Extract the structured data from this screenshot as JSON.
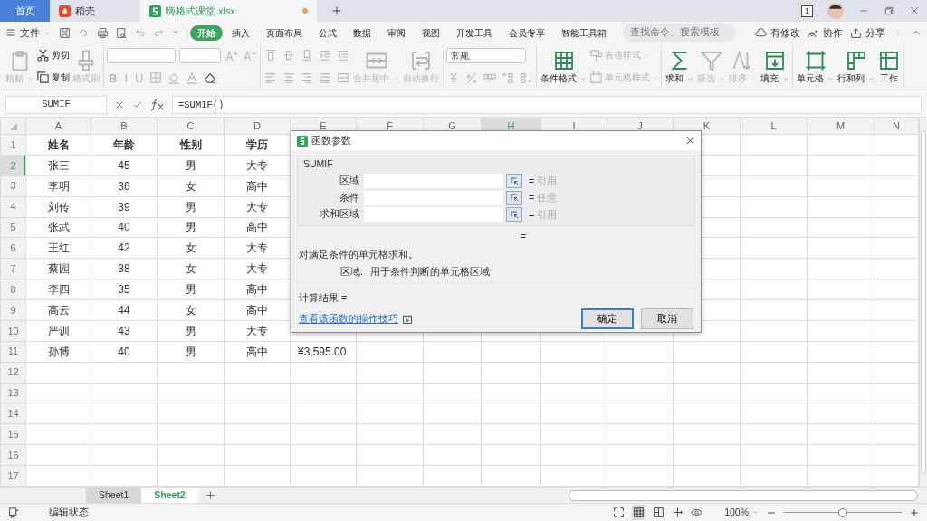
{
  "window_tabs": [
    {
      "label": "首页",
      "kind": "home",
      "selected": false
    },
    {
      "label": "稻壳",
      "kind": "docer",
      "selected": false
    },
    {
      "label": "嗨格式课堂.xlsx",
      "kind": "sheet",
      "selected": true,
      "modified": true
    }
  ],
  "window_count": "1",
  "menu": {
    "file": "文件",
    "tabs": [
      {
        "label": "开始",
        "selected": true
      },
      {
        "label": "插入",
        "selected": false
      },
      {
        "label": "页面布局",
        "selected": false
      },
      {
        "label": "公式",
        "selected": false
      },
      {
        "label": "数据",
        "selected": false
      },
      {
        "label": "审阅",
        "selected": false
      },
      {
        "label": "视图",
        "selected": false
      },
      {
        "label": "开发工具",
        "selected": false
      },
      {
        "label": "会员专享",
        "selected": false
      },
      {
        "label": "智能工具箱",
        "selected": false
      }
    ],
    "search": {
      "placeholder": "查找命令、搜索模板"
    },
    "actions": [
      "有修改",
      "协作",
      "分享"
    ]
  },
  "ribbon": [
    {
      "columns": [
        [
          {
            "kind": "large",
            "label": "粘贴",
            "disabled": true,
            "menu": true
          }
        ],
        [
          {
            "kind": "small",
            "label": "剪切",
            "disabled": false
          },
          {
            "kind": "small",
            "label": "复制",
            "disabled": false
          }
        ],
        [
          {
            "kind": "large",
            "label": "格式刷",
            "disabled": true,
            "menu": false
          }
        ]
      ]
    },
    {
      "columns": [
        [
          {
            "kind": "row",
            "items": [
              {
                "kind": "font-select"
              },
              {
                "kind": "size-select"
              },
              {
                "kind": "icon",
                "disabled": true
              },
              {
                "kind": "icon",
                "disabled": true
              }
            ]
          },
          {
            "kind": "row",
            "items": [
              {
                "kind": "format",
                "label": "B",
                "disabled": true
              },
              {
                "kind": "format",
                "label": "I",
                "disabled": true
              },
              {
                "kind": "format",
                "label": "U",
                "disabled": true
              },
              {
                "kind": "icon",
                "disabled": true
              },
              {
                "kind": "icon",
                "disabled": true
              },
              {
                "kind": "icon",
                "disabled": true
              },
              {
                "kind": "icon",
                "disabled": false
              }
            ]
          }
        ]
      ]
    },
    {
      "columns": [
        [
          {
            "kind": "row",
            "items": [
              {
                "kind": "icon",
                "disabled": true
              },
              {
                "kind": "icon",
                "disabled": true
              },
              {
                "kind": "icon",
                "disabled": true
              },
              {
                "kind": "icon",
                "disabled": true
              },
              {
                "kind": "icon",
                "disabled": true
              }
            ]
          },
          {
            "kind": "row",
            "items": [
              {
                "kind": "icon",
                "disabled": true
              },
              {
                "kind": "icon",
                "disabled": true
              },
              {
                "kind": "icon",
                "disabled": true
              },
              {
                "kind": "icon",
                "disabled": true
              },
              {
                "kind": "icon",
                "disabled": true
              }
            ]
          }
        ],
        [
          {
            "kind": "large",
            "label": "合并居中",
            "disabled": true,
            "menu": true
          }
        ],
        [
          {
            "kind": "large",
            "label": "自动换行",
            "disabled": true,
            "menu": false
          }
        ]
      ]
    },
    {
      "columns": [
        [
          {
            "kind": "format-select",
            "value": "常规"
          },
          {
            "kind": "row",
            "items": [
              {
                "kind": "icon",
                "disabled": true
              },
              {
                "kind": "icon",
                "disabled": true
              },
              {
                "kind": "icon",
                "disabled": true
              },
              {
                "kind": "icon",
                "disabled": true
              },
              {
                "kind": "icon",
                "disabled": true
              }
            ]
          }
        ]
      ]
    },
    {
      "columns": [
        [
          {
            "kind": "large",
            "label": "条件格式",
            "disabled": false,
            "menu": true
          }
        ],
        [
          {
            "kind": "small",
            "label": "表格样式",
            "disabled": true,
            "menu": true
          },
          {
            "kind": "small",
            "label": "单元格样式",
            "disabled": true,
            "menu": true
          }
        ]
      ]
    },
    {
      "columns": [
        [
          {
            "kind": "large",
            "label": "求和",
            "disabled": false,
            "menu": true
          }
        ],
        [
          {
            "kind": "large",
            "label": "筛选",
            "disabled": true,
            "menu": true
          }
        ],
        [
          {
            "kind": "large",
            "label": "排序",
            "disabled": true,
            "menu": true
          }
        ],
        [
          {
            "kind": "large",
            "label": "填充",
            "disabled": false,
            "menu": true
          }
        ]
      ]
    },
    {
      "columns": [
        [
          {
            "kind": "large",
            "label": "单元格",
            "disabled": false,
            "menu": true
          }
        ],
        [
          {
            "kind": "large",
            "label": "行和列",
            "disabled": false,
            "menu": true
          }
        ],
        [
          {
            "kind": "large",
            "label": "工作",
            "disabled": false,
            "menu": false
          }
        ]
      ]
    }
  ],
  "formula_bar": {
    "name_box": "SUMIF",
    "formula": "=SUMIF()"
  },
  "columns": [
    {
      "label": "A",
      "selected": false
    },
    {
      "label": "B",
      "selected": false
    },
    {
      "label": "C",
      "selected": false
    },
    {
      "label": "D",
      "selected": false
    },
    {
      "label": "E",
      "selected": false
    },
    {
      "label": "F",
      "selected": false
    },
    {
      "label": "G",
      "selected": false
    },
    {
      "label": "H",
      "selected": true
    },
    {
      "label": "I",
      "selected": false
    },
    {
      "label": "J",
      "selected": false
    },
    {
      "label": "K",
      "selected": false
    },
    {
      "label": "L",
      "selected": false
    },
    {
      "label": "M",
      "selected": false
    },
    {
      "label": "N",
      "selected": false
    }
  ],
  "row_numbers": [
    {
      "label": "1",
      "selected": false
    },
    {
      "label": "2",
      "selected": true
    },
    {
      "label": "3",
      "selected": false
    },
    {
      "label": "4",
      "selected": false
    },
    {
      "label": "5",
      "selected": false
    },
    {
      "label": "6",
      "selected": false
    },
    {
      "label": "7",
      "selected": false
    },
    {
      "label": "8",
      "selected": false
    },
    {
      "label": "9",
      "selected": false
    },
    {
      "label": "10",
      "selected": false
    },
    {
      "label": "11",
      "selected": false
    },
    {
      "label": "12",
      "selected": false
    },
    {
      "label": "13",
      "selected": false
    },
    {
      "label": "14",
      "selected": false
    },
    {
      "label": "15",
      "selected": false
    },
    {
      "label": "16",
      "selected": false
    },
    {
      "label": "17",
      "selected": false
    }
  ],
  "rows": [
    [
      "姓名",
      "年龄",
      "性别",
      "学历"
    ],
    [
      "张三",
      "45",
      "男",
      "大专"
    ],
    [
      "李明",
      "36",
      "女",
      "高中"
    ],
    [
      "刘传",
      "39",
      "男",
      "大专"
    ],
    [
      "张武",
      "40",
      "男",
      "高中"
    ],
    [
      "王红",
      "42",
      "女",
      "大专"
    ],
    [
      "蔡园",
      "38",
      "女",
      "大专"
    ],
    [
      "李四",
      "35",
      "男",
      "高中"
    ],
    [
      "高云",
      "44",
      "女",
      "高中"
    ],
    [
      "严训",
      "43",
      "男",
      "大专"
    ],
    [
      "孙博",
      "40",
      "男",
      "高中",
      "¥3,595.00"
    ]
  ],
  "dialog": {
    "title": "函数参数",
    "function": "SUMIF",
    "arguments": [
      {
        "label": "区域",
        "equals": "=",
        "type": "引用"
      },
      {
        "label": "条件",
        "equals": "=",
        "type": "任意"
      },
      {
        "label": "求和区域",
        "equals": "=",
        "type": "引用"
      }
    ],
    "result_line": "=",
    "description": "对满足条件的单元格求和。",
    "argument_name": "区域:",
    "argument_help": "用于条件判断的单元格区域",
    "result": "计算结果 =",
    "help_link": "查看该函数的操作技巧",
    "buttons": [
      {
        "label": "确定",
        "selected": true
      },
      {
        "label": "取消",
        "selected": false
      }
    ]
  },
  "sheets": [
    {
      "label": "Sheet1",
      "selected": false
    },
    {
      "label": "Sheet2",
      "selected": true
    }
  ],
  "status_bar": {
    "mode": "编辑状态",
    "zoom": "100%",
    "zoom_level": {
      "level": 0.5
    }
  }
}
